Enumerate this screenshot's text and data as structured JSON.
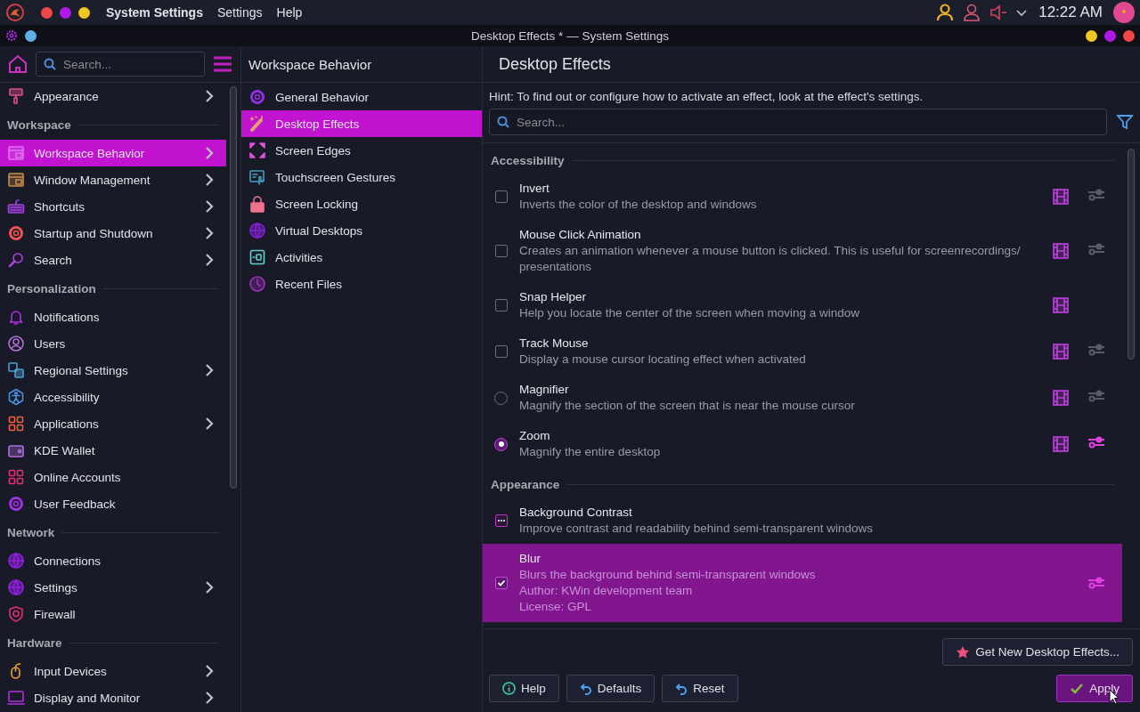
{
  "top_panel": {
    "app_name": "System Settings",
    "menus": [
      "Settings",
      "Help"
    ],
    "clock": "12:22 AM"
  },
  "window": {
    "title": "Desktop Effects * — System Settings"
  },
  "sidebar": {
    "search": {
      "placeholder": "Search..."
    },
    "groups": [
      {
        "items": [
          {
            "label": "Appearance",
            "has_children": true,
            "selected": false
          }
        ]
      },
      {
        "heading": "Workspace",
        "items": [
          {
            "label": "Workspace Behavior",
            "has_children": true,
            "selected": true
          },
          {
            "label": "Window Management",
            "has_children": true,
            "selected": false
          },
          {
            "label": "Shortcuts",
            "has_children": true,
            "selected": false
          },
          {
            "label": "Startup and Shutdown",
            "has_children": true,
            "selected": false
          },
          {
            "label": "Search",
            "has_children": true,
            "selected": false
          }
        ]
      },
      {
        "heading": "Personalization",
        "items": [
          {
            "label": "Notifications",
            "has_children": false,
            "selected": false
          },
          {
            "label": "Users",
            "has_children": false,
            "selected": false
          },
          {
            "label": "Regional Settings",
            "has_children": true,
            "selected": false
          },
          {
            "label": "Accessibility",
            "has_children": false,
            "selected": false
          },
          {
            "label": "Applications",
            "has_children": true,
            "selected": false
          },
          {
            "label": "KDE Wallet",
            "has_children": false,
            "selected": false
          },
          {
            "label": "Online Accounts",
            "has_children": false,
            "selected": false
          },
          {
            "label": "User Feedback",
            "has_children": false,
            "selected": false
          }
        ]
      },
      {
        "heading": "Network",
        "items": [
          {
            "label": "Connections",
            "has_children": false,
            "selected": false
          },
          {
            "label": "Settings",
            "has_children": true,
            "selected": false
          },
          {
            "label": "Firewall",
            "has_children": false,
            "selected": false
          }
        ]
      },
      {
        "heading": "Hardware",
        "items": [
          {
            "label": "Input Devices",
            "has_children": true,
            "selected": false
          },
          {
            "label": "Display and Monitor",
            "has_children": true,
            "selected": false
          }
        ]
      }
    ]
  },
  "subpanel": {
    "title": "Workspace Behavior",
    "items": [
      {
        "label": "General Behavior",
        "selected": false
      },
      {
        "label": "Desktop Effects",
        "selected": true
      },
      {
        "label": "Screen Edges",
        "selected": false
      },
      {
        "label": "Touchscreen Gestures",
        "selected": false
      },
      {
        "label": "Screen Locking",
        "selected": false
      },
      {
        "label": "Virtual Desktops",
        "selected": false
      },
      {
        "label": "Activities",
        "selected": false
      },
      {
        "label": "Recent Files",
        "selected": false
      }
    ]
  },
  "content": {
    "title": "Desktop Effects",
    "hint": "Hint: To find out or configure how to activate an effect, look at the effect's settings.",
    "search": {
      "placeholder": "Search..."
    },
    "sections": [
      {
        "heading": "Accessibility",
        "effects": [
          {
            "name": "Invert",
            "description": "Inverts the color of the desktop and windows",
            "kind": "checkbox",
            "checked": false,
            "preview": true,
            "configurable": true,
            "configure_active": false,
            "selected": false
          },
          {
            "name": "Mouse Click Animation",
            "description": "Creates an animation whenever a mouse button is clicked. This is useful for screenrecordings/ presentations",
            "kind": "checkbox",
            "checked": false,
            "preview": true,
            "configurable": true,
            "configure_active": false,
            "selected": false
          },
          {
            "name": "Snap Helper",
            "description": "Help you locate the center of the screen when moving a window",
            "kind": "checkbox",
            "checked": false,
            "preview": true,
            "configurable": false,
            "selected": false
          },
          {
            "name": "Track Mouse",
            "description": "Display a mouse cursor locating effect when activated",
            "kind": "checkbox",
            "checked": false,
            "preview": true,
            "configurable": true,
            "configure_active": false,
            "selected": false
          },
          {
            "name": "Magnifier",
            "description": "Magnify the section of the screen that is near the mouse cursor",
            "kind": "radio",
            "checked": false,
            "preview": true,
            "configurable": true,
            "configure_active": false,
            "selected": false
          },
          {
            "name": "Zoom",
            "description": "Magnify the entire desktop",
            "kind": "radio",
            "checked": true,
            "preview": true,
            "configurable": true,
            "configure_active": true,
            "selected": false
          }
        ]
      },
      {
        "heading": "Appearance",
        "effects": [
          {
            "name": "Background Contrast",
            "description": "Improve contrast and readability behind semi-transparent windows",
            "kind": "tristate",
            "partial": true,
            "preview": false,
            "configurable": false,
            "selected": false
          },
          {
            "name": "Blur",
            "description": "Blurs the background behind semi-transparent windows",
            "details": [
              "Author: KWin development team",
              "License: GPL"
            ],
            "kind": "checkbox",
            "checked": true,
            "preview": false,
            "configurable": true,
            "configure_active": true,
            "selected": true
          }
        ]
      }
    ]
  },
  "buttons": {
    "get_new": "Get New Desktop Effects...",
    "help": "Help",
    "defaults": "Defaults",
    "reset": "Reset",
    "apply": "Apply"
  }
}
